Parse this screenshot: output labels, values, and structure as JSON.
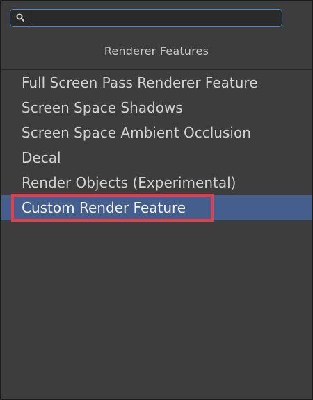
{
  "search": {
    "value": "",
    "placeholder": ""
  },
  "header": {
    "title": "Renderer Features"
  },
  "items": [
    {
      "label": "Full Screen Pass Renderer Feature"
    },
    {
      "label": "Screen Space Shadows"
    },
    {
      "label": "Screen Space Ambient Occlusion"
    },
    {
      "label": "Decal"
    },
    {
      "label": "Render Objects (Experimental)"
    },
    {
      "label": "Custom Render Feature"
    }
  ],
  "selected_item": "Custom Render Feature",
  "colors": {
    "background": "#3d3d3d",
    "search_border": "#4d89c9",
    "selection": "#445f8e",
    "highlight_annotation": "#e63d4a"
  },
  "icons": {
    "search": "search-icon"
  }
}
